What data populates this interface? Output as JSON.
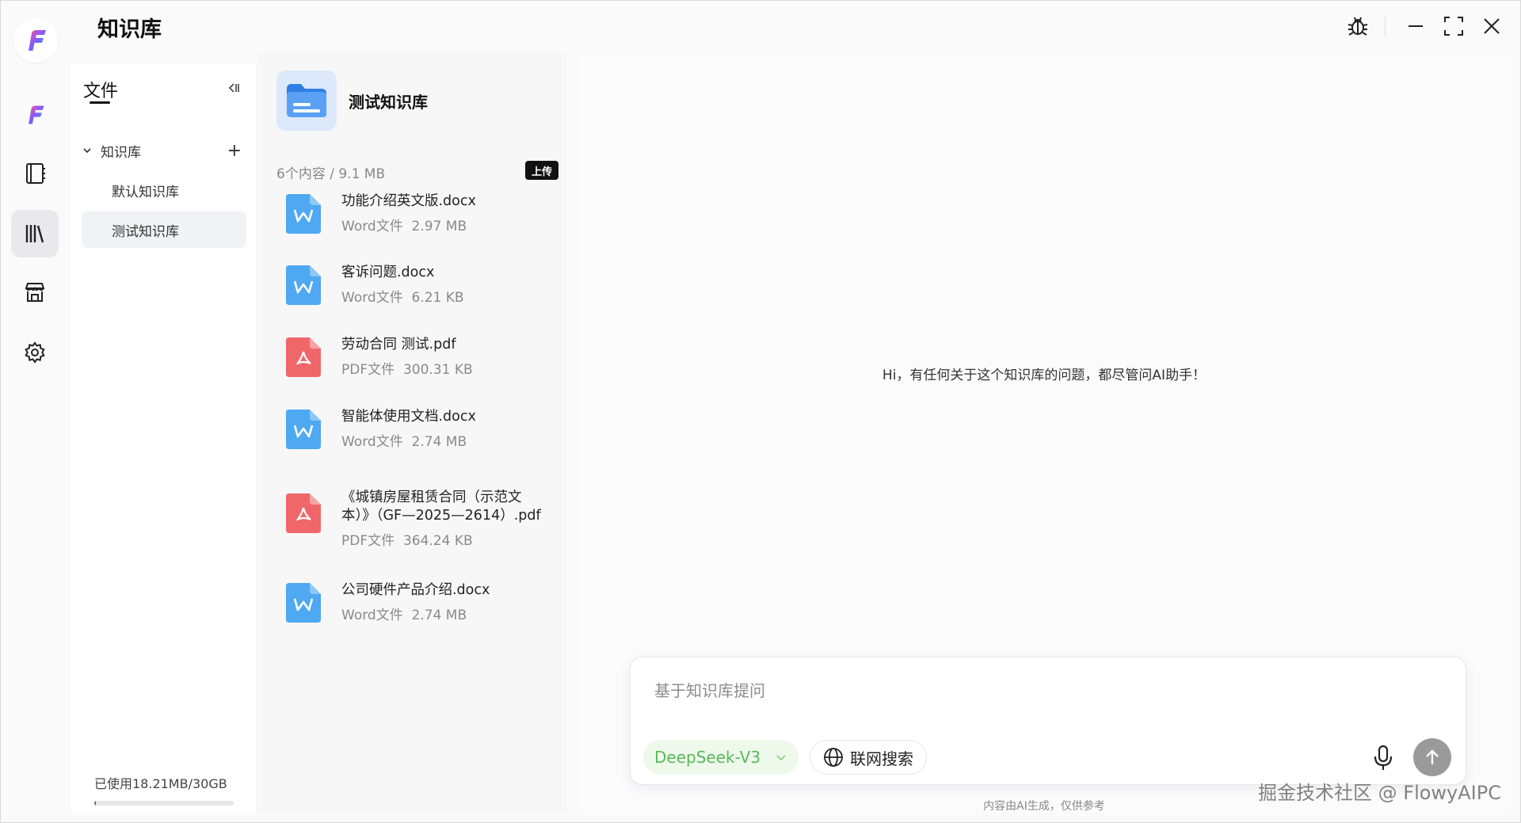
{
  "app": {
    "title": "知识库"
  },
  "window_controls": {
    "debug_icon": "bug-icon",
    "minimize_icon": "minimize-icon",
    "maximize_icon": "maximize-icon",
    "close_icon": "close-icon"
  },
  "rail": {
    "items": [
      {
        "icon": "app-logo-icon"
      },
      {
        "icon": "notebook-icon"
      },
      {
        "icon": "library-icon",
        "active": true
      },
      {
        "icon": "store-icon"
      },
      {
        "icon": "settings-icon"
      }
    ]
  },
  "tree": {
    "header": "文件",
    "group_label": "知识库",
    "items": [
      {
        "label": "默认知识库",
        "active": false
      },
      {
        "label": "测试知识库",
        "active": true
      }
    ],
    "usage_text": "已使用18.21MB/30GB",
    "usage_fraction": 0.0006
  },
  "kb": {
    "name": "测试知识库",
    "meta": "6个内容 / 9.1 MB",
    "upload_label": "上传",
    "files": [
      {
        "name": "功能介绍英文版.docx",
        "type": "word",
        "type_label": "Word文件",
        "size": "2.97 MB"
      },
      {
        "name": "客诉问题.docx",
        "type": "word",
        "type_label": "Word文件",
        "size": "6.21 KB"
      },
      {
        "name": "劳动合同 测试.pdf",
        "type": "pdf",
        "type_label": "PDF文件",
        "size": "300.31 KB"
      },
      {
        "name": "智能体使用文档.docx",
        "type": "word",
        "type_label": "Word文件",
        "size": "2.74 MB"
      },
      {
        "name": "《城镇房屋租赁合同（示范文本）》（GF—2025—2614）.pdf",
        "name_line1": "《城镇房屋租赁合同（示范文",
        "name_line2": "本）》（GF—2025—2614）.pdf",
        "type": "pdf",
        "type_label": "PDF文件",
        "size": "364.24 KB"
      },
      {
        "name": "公司硬件产品介绍.docx",
        "type": "word",
        "type_label": "Word文件",
        "size": "2.74 MB"
      }
    ]
  },
  "chat": {
    "greeting": "Hi，有任何关于这个知识库的问题，都尽管问AI助手！",
    "input_placeholder": "基于知识库提问",
    "model": "DeepSeek-V3",
    "web_search_label": "联网搜索",
    "disclaimer": "内容由AI生成，仅供参考"
  },
  "watermark": "掘金技术社区 @ FlowyAIPC",
  "colors": {
    "word_blue": "#4ea8f2",
    "pdf_red": "#f0676a",
    "model_green": "#5ab85a"
  }
}
